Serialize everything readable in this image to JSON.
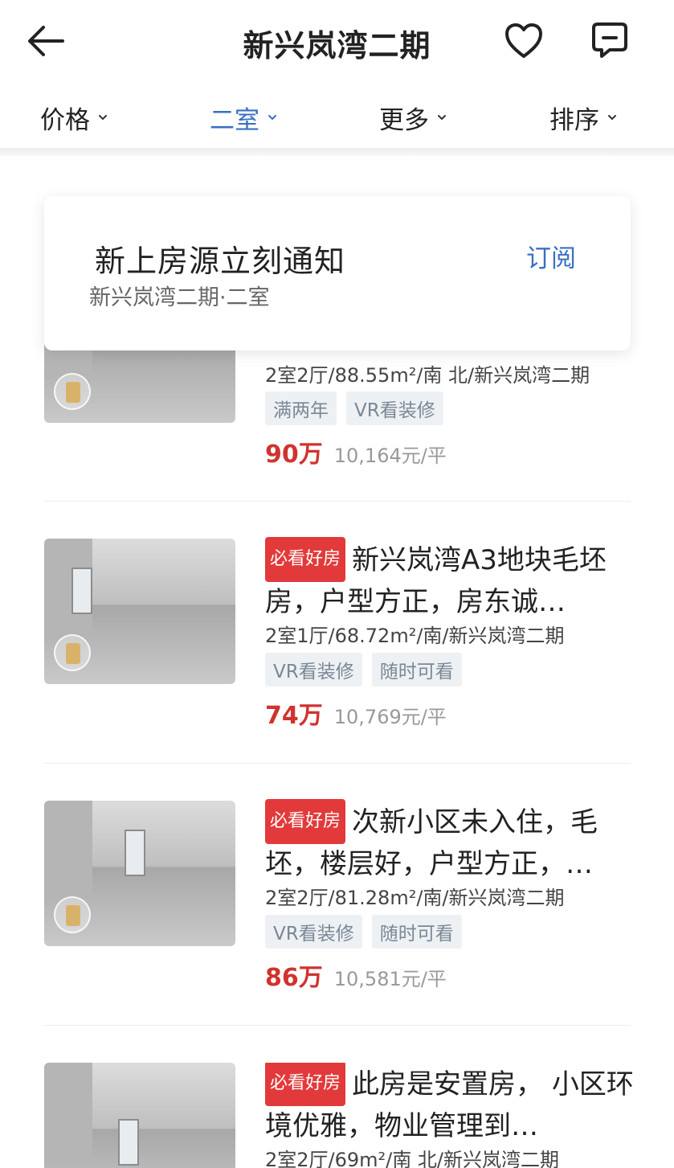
{
  "header": {
    "title": "新兴岚湾二期",
    "back_icon": "back-arrow-icon",
    "favorite_icon": "heart-icon",
    "message_icon": "message-icon"
  },
  "filters": [
    {
      "label": "价格",
      "active": false
    },
    {
      "label": "二室",
      "active": true
    },
    {
      "label": "更多",
      "active": false
    },
    {
      "label": "排序",
      "active": false
    }
  ],
  "colors": {
    "accent": "#3a6fc4",
    "price": "#d0332f",
    "badge": "#e23a3a"
  },
  "subscribe": {
    "title": "新上房源立刻通知",
    "desc": "新兴岚湾二期·二室",
    "button": "订阅"
  },
  "listings": [
    {
      "badge": "",
      "title": "",
      "meta": "2室2厅/88.55m²/南 北/新兴岚湾二期",
      "tags": [
        "满两年",
        "VR看装修"
      ],
      "price": "90万",
      "unit_price": "10,164元/平"
    },
    {
      "badge": "必看好房",
      "title": "新兴岚湾A3地块毛坯房，户型方正，房东诚…",
      "meta": "2室1厅/68.72m²/南/新兴岚湾二期",
      "tags": [
        "VR看装修",
        "随时可看"
      ],
      "price": "74万",
      "unit_price": "10,769元/平"
    },
    {
      "badge": "必看好房",
      "title": "次新小区未入住，毛坯，楼层好，户型方正，…",
      "meta": "2室2厅/81.28m²/南/新兴岚湾二期",
      "tags": [
        "VR看装修",
        "随时可看"
      ],
      "price": "86万",
      "unit_price": "10,581元/平"
    },
    {
      "badge": "必看好房",
      "title": "此房是安置房， 小区环境优雅，物业管理到…",
      "meta": "2室2厅/69m²/南 北/新兴岚湾二期",
      "tags": [],
      "price": "",
      "unit_price": ""
    }
  ]
}
